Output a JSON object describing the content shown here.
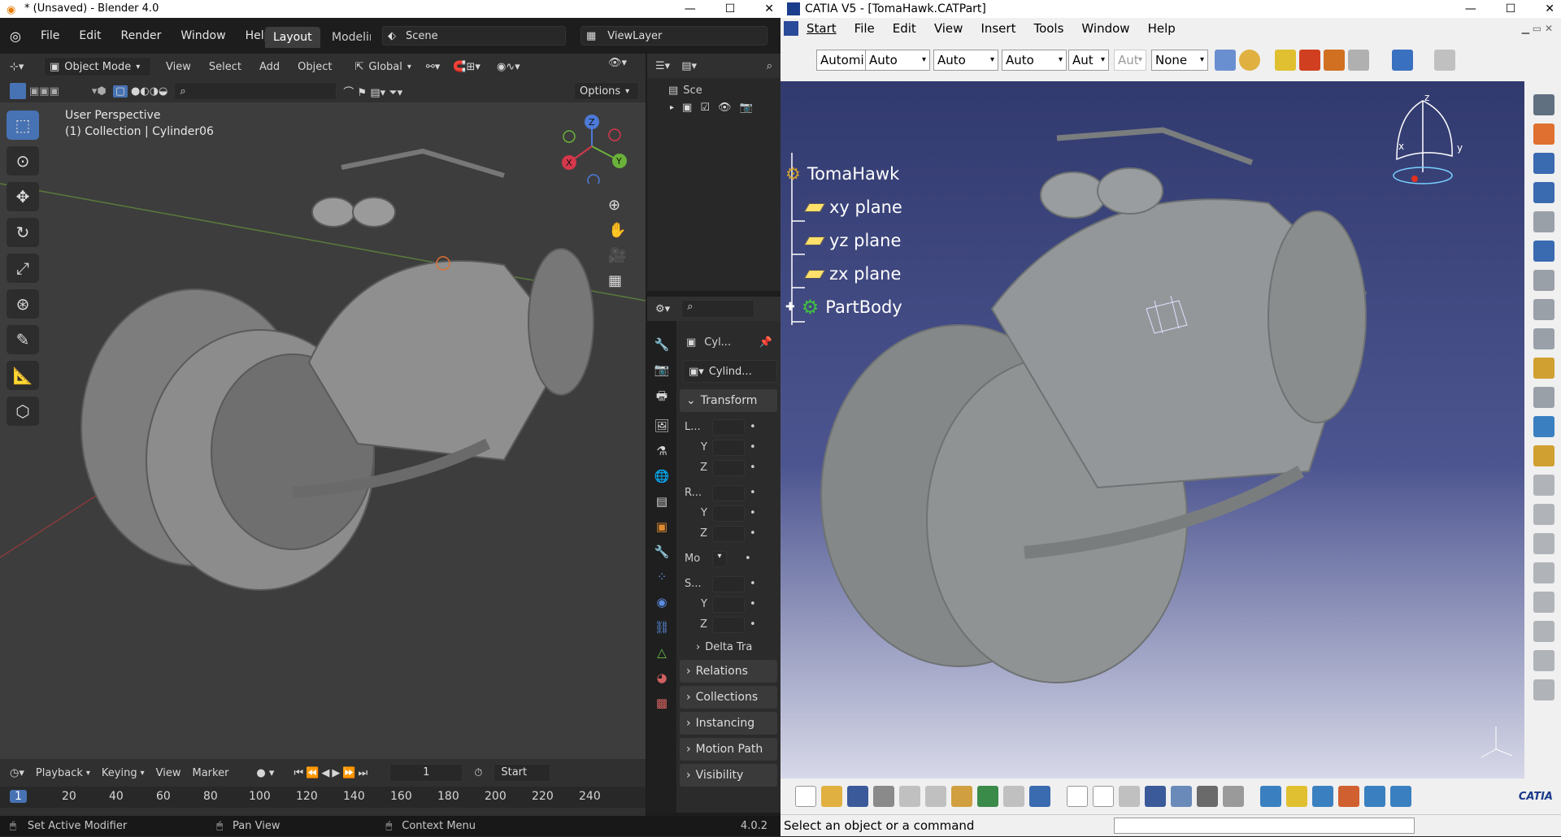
{
  "blender": {
    "window_title": "* (Unsaved) - Blender 4.0",
    "menu": [
      "File",
      "Edit",
      "Render",
      "Window",
      "Help"
    ],
    "workspaces": [
      "Layout",
      "Modelir"
    ],
    "scene_name": "Scene",
    "view_layer": "ViewLayer",
    "viewport_header": {
      "mode": "Object Mode",
      "menus": [
        "View",
        "Select",
        "Add",
        "Object"
      ],
      "orientation": "Global",
      "options_label": "Options"
    },
    "viewport": {
      "perspective_label": "User Perspective",
      "object_label": "(1) Collection | Cylinder06",
      "gizmo_axes": [
        "X",
        "Y",
        "Z"
      ]
    },
    "outliner": {
      "scene_item": "Sce"
    },
    "properties": {
      "object_name_short": "Cyl...",
      "object_data_name": "Cylind...",
      "transform_panel": "Transform",
      "location_label": "L...",
      "rotation_label": "R...",
      "mode_label": "Mo",
      "scale_label": "S...",
      "axis_y": "Y",
      "axis_z": "Z",
      "collapsed_panels": [
        "Delta Tra",
        "Relations",
        "Collections",
        "Instancing",
        "Motion Path",
        "Visibility"
      ]
    },
    "timeline": {
      "menus": [
        "Playback",
        "Keying",
        "View",
        "Marker"
      ],
      "current_frame": "1",
      "start_label": "Start",
      "ruler_marks": [
        "1",
        "20",
        "40",
        "60",
        "80",
        "100",
        "120",
        "140",
        "160",
        "180",
        "200",
        "220",
        "240"
      ]
    },
    "status_bar": {
      "left": "Set Active Modifier",
      "middle": "Pan View",
      "right": "Context Menu",
      "version": "4.0.2"
    },
    "accent_color": "#4772b3"
  },
  "catia": {
    "window_title": "CATIA V5 - [TomaHawk.CATPart]",
    "menu": [
      "Start",
      "File",
      "Edit",
      "View",
      "Insert",
      "Tools",
      "Window",
      "Help"
    ],
    "toolbar_dropdowns": [
      "Automi",
      "Auto",
      "Auto",
      "Auto",
      "Aut",
      "Aut",
      "None"
    ],
    "tree": {
      "root": "TomaHawk",
      "planes": [
        "xy plane",
        "yz plane",
        "zx plane"
      ],
      "body": "PartBody"
    },
    "compass_axes": [
      "z",
      "x",
      "y"
    ],
    "status_text": "Select an object or a command",
    "brand": "CATIA",
    "viewport_top_color": "#313a6e",
    "viewport_bottom_color": "#d7d8e8"
  }
}
